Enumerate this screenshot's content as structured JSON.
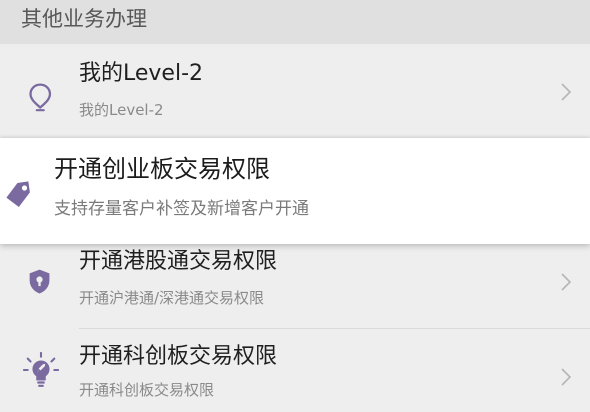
{
  "section": {
    "title": "其他业务办理"
  },
  "items": [
    {
      "title": "我的Level-2",
      "subtitle": "我的Level-2",
      "icon": "location-pin-icon"
    },
    {
      "title": "开通创业板交易权限",
      "subtitle": "支持存量客户补签及新增客户开通",
      "icon": "tag-icon"
    },
    {
      "title": "开通港股通交易权限",
      "subtitle": "开通沪港通/深港通交易权限",
      "icon": "shield-icon"
    },
    {
      "title": "开通科创板交易权限",
      "subtitle": "开通科创板交易权限",
      "icon": "lightbulb-icon"
    }
  ],
  "colors": {
    "icon": "#7a6aa0",
    "background": "#ededed",
    "card": "#ffffff"
  }
}
